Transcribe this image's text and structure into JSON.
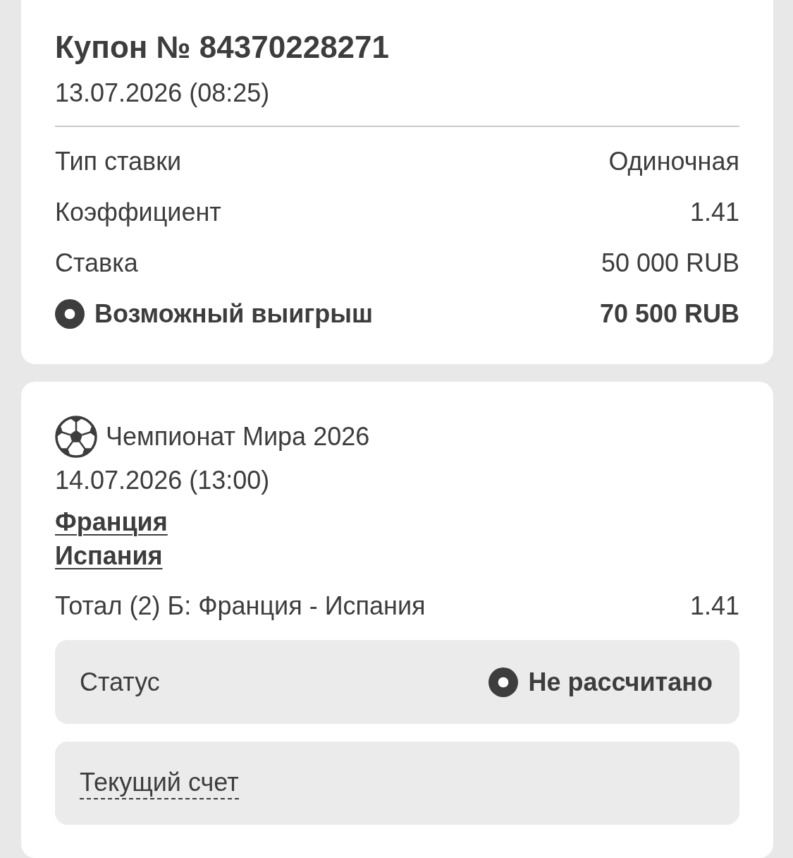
{
  "coupon": {
    "title": "Купон № 84370228271",
    "date": "13.07.2026 (08:25)",
    "rows": [
      {
        "kind": "plain",
        "label": "Тип ставки",
        "value": "Одиночная"
      },
      {
        "kind": "plain",
        "label": "Коэффициент",
        "value": "1.41"
      },
      {
        "kind": "plain",
        "label": "Ставка",
        "value": "50 000 RUB"
      },
      {
        "kind": "total",
        "label": "Возможный выигрыш",
        "value": "70 500 RUB"
      }
    ]
  },
  "event": {
    "league": "Чемпионат Мира 2026",
    "date": "14.07.2026 (13:00)",
    "teams": [
      "Франция",
      "Испания"
    ],
    "bet": {
      "market": "Тотал (2) Б: Франция - Испания",
      "odds": "1.41"
    },
    "status": {
      "label": "Статус",
      "value": "Не рассчитано"
    },
    "score": {
      "label": "Текущий счет"
    }
  }
}
